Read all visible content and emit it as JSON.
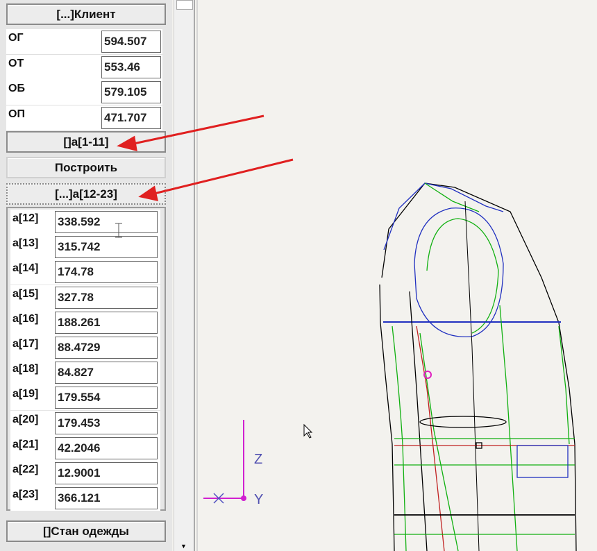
{
  "client_button": "[...]Клиент",
  "client_params": [
    {
      "label": "ОГ",
      "value": "594.507"
    },
    {
      "label": "ОТ",
      "value": "553.46"
    },
    {
      "label": "ОБ",
      "value": "579.105"
    },
    {
      "label": "ОП",
      "value": "471.707"
    }
  ],
  "a1_11_button": "[]a[1-11]",
  "build_button": "Построить",
  "a12_23_button": "[...]a[12-23]",
  "a_params": [
    {
      "label": "a[12]",
      "value": "338.592"
    },
    {
      "label": "a[13]",
      "value": "315.742"
    },
    {
      "label": "a[14]",
      "value": "174.78"
    },
    {
      "label": "a[15]",
      "value": "327.78"
    },
    {
      "label": "a[16]",
      "value": "188.261"
    },
    {
      "label": "a[17]",
      "value": "88.4729"
    },
    {
      "label": "a[18]",
      "value": "84.827"
    },
    {
      "label": "a[19]",
      "value": "179.554"
    },
    {
      "label": "a[20]",
      "value": "179.453"
    },
    {
      "label": "a[21]",
      "value": "42.2046"
    },
    {
      "label": "a[22]",
      "value": "12.9001"
    },
    {
      "label": "a[23]",
      "value": "366.121"
    }
  ],
  "stan_button": "[]Стан одежды",
  "axes": {
    "z": "Z",
    "y": "Y"
  }
}
